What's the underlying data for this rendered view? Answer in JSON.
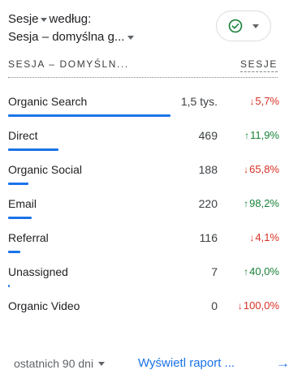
{
  "header": {
    "metric_label": "Sesje",
    "by_label": "według:",
    "dimension_label": "Sesja – domyślna g..."
  },
  "filter": {
    "icon": "check-circle-icon",
    "status_color": "#188038"
  },
  "table": {
    "dimension_header": "SESJA – DOMYŚLN...",
    "metric_header": "SESJE",
    "rows": [
      {
        "label": "Organic Search",
        "value": "1,5 tys.",
        "change": "5,7%",
        "direction": "down",
        "share": 1.0
      },
      {
        "label": "Direct",
        "value": "469",
        "change": "11,9%",
        "direction": "up",
        "share": 0.31
      },
      {
        "label": "Organic Social",
        "value": "188",
        "change": "65,8%",
        "direction": "down",
        "share": 0.125
      },
      {
        "label": "Email",
        "value": "220",
        "change": "98,2%",
        "direction": "up",
        "share": 0.146
      },
      {
        "label": "Referral",
        "value": "116",
        "change": "4,1%",
        "direction": "down",
        "share": 0.077
      },
      {
        "label": "Unassigned",
        "value": "7",
        "change": "40,0%",
        "direction": "up",
        "share": 0.005
      },
      {
        "label": "Organic Video",
        "value": "0",
        "change": "100,0%",
        "direction": "down",
        "share": 0.0
      }
    ]
  },
  "footer": {
    "date_range": "ostatnich 90 dni",
    "view_report": "Wyświetl raport ..."
  },
  "colors": {
    "accent": "#1a73e8",
    "up": "#188038",
    "down": "#d93025"
  }
}
